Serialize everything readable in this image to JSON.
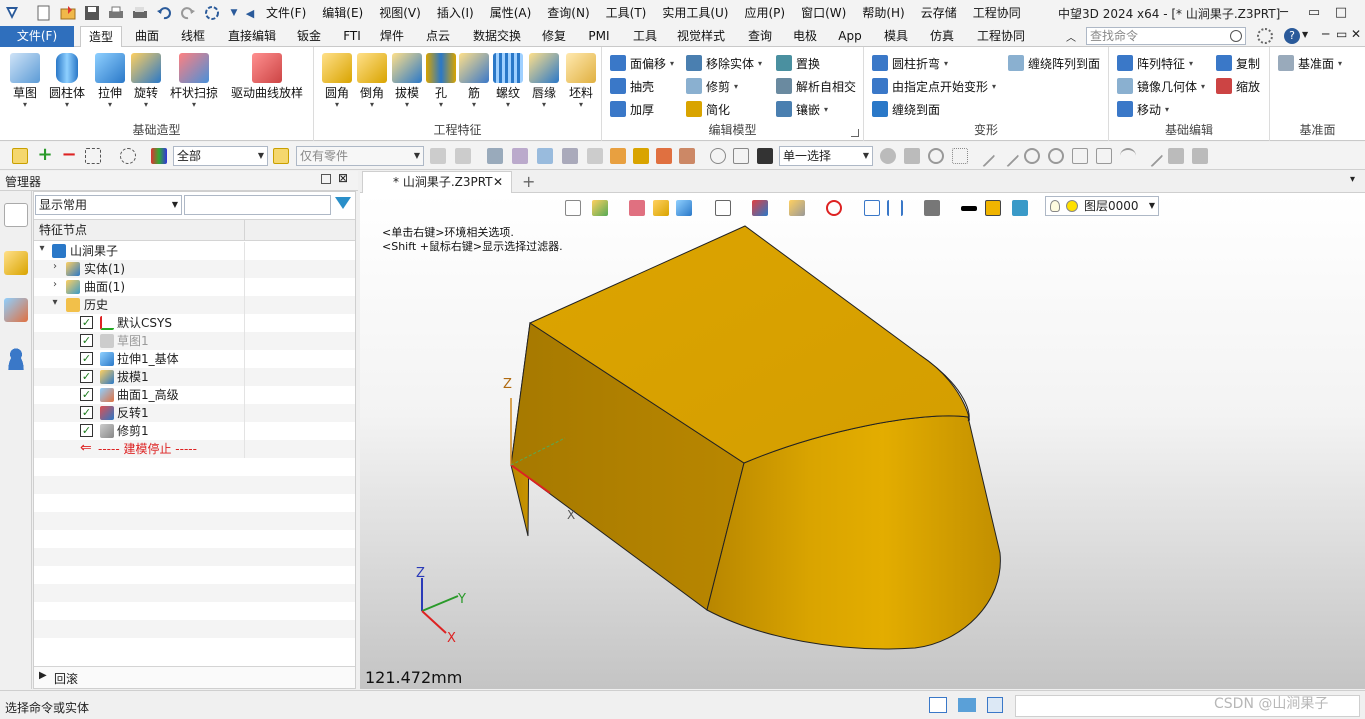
{
  "title": "中望3D 2024 x64 - [* 山涧果子.Z3PRT]",
  "menu": [
    "文件(F)",
    "编辑(E)",
    "视图(V)",
    "插入(I)",
    "属性(A)",
    "查询(N)",
    "工具(T)",
    "实用工具(U)",
    "应用(P)",
    "窗口(W)",
    "帮助(H)",
    "云存储",
    "工程协同"
  ],
  "tabs": [
    "文件(F)",
    "造型",
    "曲面",
    "线框",
    "直接编辑",
    "钣金",
    "FTI",
    "焊件",
    "点云",
    "数据交换",
    "修复",
    "PMI",
    "工具",
    "视觉样式",
    "查询",
    "电极",
    "App",
    "模具",
    "仿真",
    "工程协同"
  ],
  "search_placeholder": "查找命令",
  "ribbon": {
    "basic": {
      "label": "基础造型",
      "buttons": [
        "草图",
        "圆柱体",
        "拉伸",
        "旋转",
        "杆状扫掠",
        "驱动曲线放样"
      ]
    },
    "features": {
      "label": "工程特征",
      "buttons": [
        "圆角",
        "倒角",
        "拔模",
        "孔",
        "筋",
        "螺纹",
        "唇缘",
        "坯料"
      ]
    },
    "edit": {
      "label": "编辑模型",
      "items": [
        "面偏移",
        "移除实体",
        "置换",
        "抽壳",
        "修剪",
        "解析自相交",
        "加厚",
        "简化",
        "镶嵌"
      ]
    },
    "deform": {
      "label": "变形",
      "items": [
        "圆柱折弯",
        "缠绕阵列到面",
        "由指定点开始变形",
        "缠绕到面"
      ]
    },
    "basicedit": {
      "label": "基础编辑",
      "items": [
        "阵列特征",
        "复制",
        "镜像几何体",
        "缩放",
        "移动"
      ]
    },
    "datum": {
      "label": "基准面",
      "items": [
        "基准面"
      ]
    }
  },
  "toolbar": {
    "filter_all": "全部",
    "parts_only": "仅有零件",
    "select_mode": "单一选择"
  },
  "manager": {
    "title": "管理器",
    "display_filter": "显示常用",
    "column_header": "特征节点",
    "root": "山涧果子",
    "nodes": [
      {
        "label": "实体(1)"
      },
      {
        "label": "曲面(1)"
      },
      {
        "label": "历史"
      }
    ],
    "history": [
      {
        "label": "默认CSYS",
        "dim": false
      },
      {
        "label": "草图1",
        "dim": true
      },
      {
        "label": "拉伸1_基体",
        "dim": false
      },
      {
        "label": "拔模1",
        "dim": false
      },
      {
        "label": "曲面1_高级",
        "dim": false
      },
      {
        "label": "反转1",
        "dim": false
      },
      {
        "label": "修剪1",
        "dim": false
      }
    ],
    "stop_marker": "----- 建模停止 -----",
    "rollback": "回滚"
  },
  "document_tab": "* 山涧果子.Z3PRT",
  "viewport": {
    "hint1": "<单击右键>环境相关选项.",
    "hint2": "<Shift +鼠标右键>显示选择过滤器.",
    "measure": "121.472mm",
    "layer": "图层0000",
    "axis_x": "X",
    "axis_y": "Y",
    "axis_z": "Z",
    "model_color": "#d9a400"
  },
  "status": "选择命令或实体",
  "watermark": "CSDN @山涧果子"
}
